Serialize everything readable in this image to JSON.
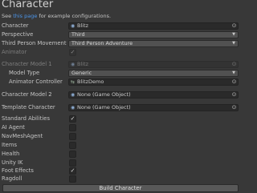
{
  "header": {
    "title": "Character",
    "subtitle_pre": "See ",
    "subtitle_link": "this page",
    "subtitle_post": " for example configurations."
  },
  "fields": {
    "character": {
      "label": "Character",
      "value": "Blitz",
      "icon": "game-object-icon"
    },
    "perspective": {
      "label": "Perspective",
      "value": "Third"
    },
    "third_person_movement": {
      "label": "Third Person Movement",
      "value": "Third Person Adventure"
    },
    "animator": {
      "label": "Animator",
      "checked": true,
      "disabled": true
    },
    "character_model_1": {
      "label": "Character Model 1",
      "value": "Blitz",
      "disabled": true
    },
    "model_type": {
      "label": "Model Type",
      "value": "Generic"
    },
    "animator_controller": {
      "label": "Animator Controller",
      "value": "BlitzDemo",
      "icon": "animator-controller-icon"
    },
    "character_model_2": {
      "label": "Character Model 2",
      "value": "None (Game Object)"
    },
    "template_character": {
      "label": "Template Character",
      "value": "None (Game Object)"
    }
  },
  "toggles": [
    {
      "label": "Standard Abilities",
      "checked": true
    },
    {
      "label": "AI Agent",
      "checked": false
    },
    {
      "label": "NavMeshAgent",
      "checked": false
    },
    {
      "label": "Items",
      "checked": false
    },
    {
      "label": "Health",
      "checked": false
    },
    {
      "label": "Unity IK",
      "checked": false
    },
    {
      "label": "Foot Effects",
      "checked": true
    },
    {
      "label": "Ragdoll",
      "checked": false
    }
  ],
  "build_button": "Build Character",
  "colors": {
    "background": "#383838",
    "link": "#4c95e9",
    "field": "#2a2a2a",
    "dropdown": "#515151",
    "button": "#585858"
  }
}
